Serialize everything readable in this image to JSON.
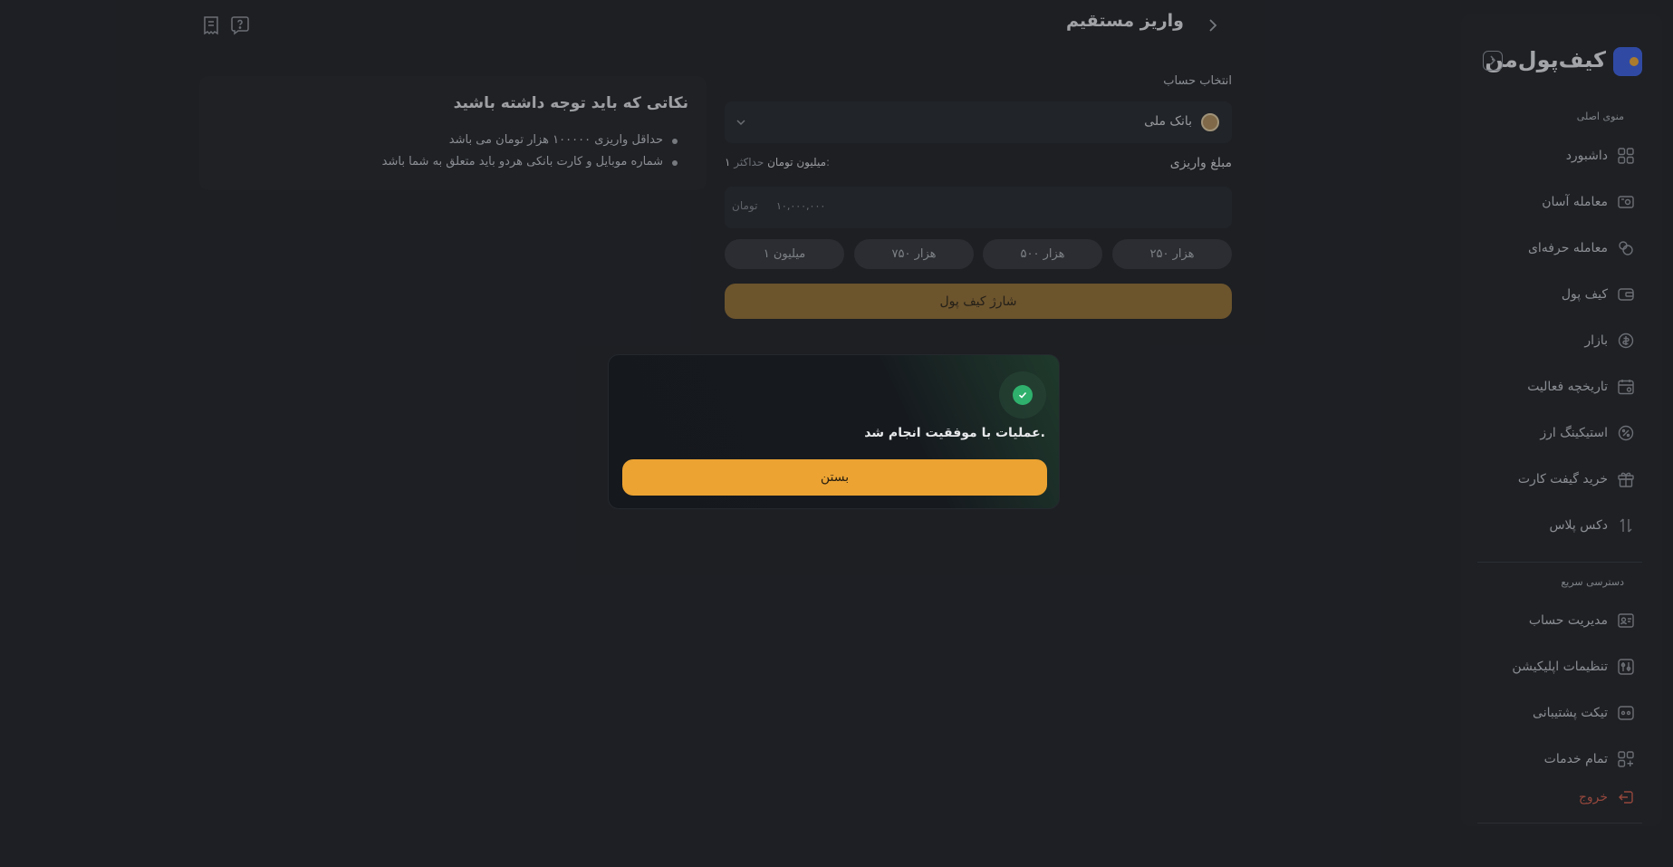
{
  "brand": {
    "name": "کیف‌پول‌من",
    "accent": "#3b5fd9",
    "gold": "#eca332"
  },
  "sidebar": {
    "main_title": "منوی اصلی",
    "items": [
      {
        "label": "داشبورد",
        "icon": "dashboard-icon"
      },
      {
        "label": "معامله آسان",
        "icon": "easy-trade-icon"
      },
      {
        "label": "معامله حرفه‌ای",
        "icon": "pro-trade-icon"
      },
      {
        "label": "کیف پول",
        "icon": "wallet-icon"
      },
      {
        "label": "بازار",
        "icon": "market-icon"
      },
      {
        "label": "تاریخچه فعالیت",
        "icon": "history-icon"
      },
      {
        "label": "استیکینگ ارز",
        "icon": "staking-icon"
      },
      {
        "label": "خرید گیفت کارت",
        "icon": "gift-card-icon"
      },
      {
        "label": "دکس پلاس",
        "icon": "dex-icon"
      }
    ],
    "quick_title": "دسترسی سریع",
    "quick_items": [
      {
        "label": "مدیریت حساب",
        "icon": "account-icon"
      },
      {
        "label": "تنظیمات اپلیکیشن",
        "icon": "settings-icon"
      },
      {
        "label": "تیکت پشتیبانی",
        "icon": "ticket-icon"
      },
      {
        "label": "تمام خدمات",
        "icon": "services-icon"
      }
    ],
    "logout": "خروج"
  },
  "header": {
    "title": "واریز مستقیم"
  },
  "form": {
    "account_label": "انتخاب حساب",
    "bank": "بانک ملی",
    "amount_label": "مبلغ واریزی",
    "max_prefix": "حداکثر:",
    "max_value": "۱ میلیون تومان",
    "amount_value": "۱۰,۰۰۰,۰۰۰",
    "unit": "تومان",
    "chips": [
      "۲۵۰ هزار",
      "۵۰۰ هزار",
      "۷۵۰ هزار",
      "۱ میلیون"
    ],
    "submit": "شارژ کیف پول"
  },
  "notes": {
    "title": "نکاتی که باید توجه داشته باشید",
    "items": [
      "حداقل واریزی ۱۰۰۰۰۰ هزار تومان می باشد",
      "شماره موبایل و کارت بانکی هردو باید متعلق به شما باشد"
    ]
  },
  "modal": {
    "message": "عملیات با موفقیت انجام شد.",
    "close": "بستن"
  }
}
